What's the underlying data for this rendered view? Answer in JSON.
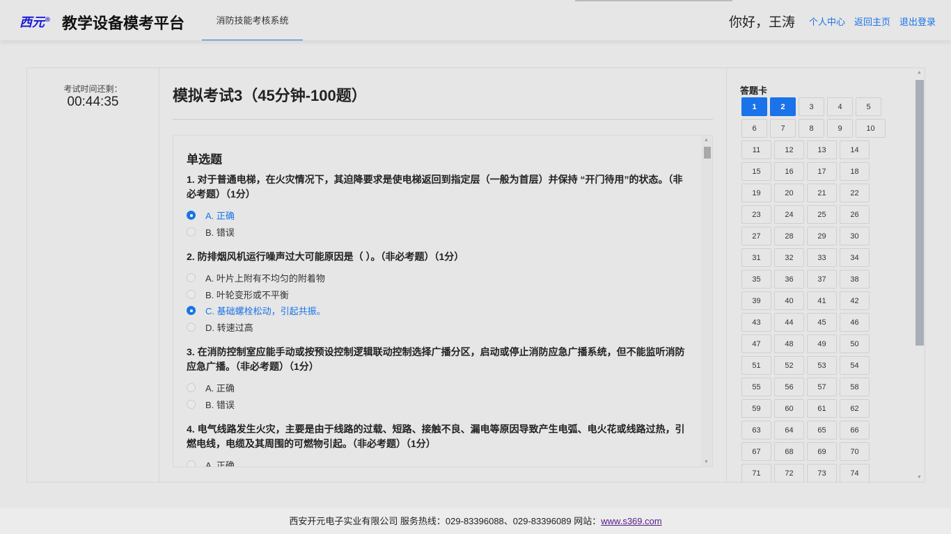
{
  "header": {
    "logo_text": "西元",
    "brand": "教学设备模考平台",
    "nav_tab": "消防技能考核系统",
    "greeting": "你好，王涛",
    "links": [
      "个人中心",
      "返回主页",
      "退出登录"
    ]
  },
  "timer": {
    "label": "考试时间还剩：",
    "value": "00:44:35"
  },
  "exam": {
    "title": "模拟考试3（45分钟-100题）",
    "section": "单选题",
    "questions": [
      {
        "text": "1. 对于普通电梯，在火灾情况下，其迫降要求是使电梯返回到指定层（一般为首层）并保持 “开门待用”的状态。（非必考题）（1分）",
        "options": [
          "A. 正确",
          "B. 错误"
        ],
        "selected": 0
      },
      {
        "text": "2. 防排烟风机运行噪声过大可能原因是（ ）。（非必考题）（1分）",
        "options": [
          "A. 叶片上附有不均匀的附着物",
          "B. 叶轮变形或不平衡",
          "C. 基础螺栓松动，引起共振。",
          "D. 转速过高"
        ],
        "selected": 2
      },
      {
        "text": "3. 在消防控制室应能手动或按预设控制逻辑联动控制选择广播分区，启动或停止消防应急广播系统，但不能监听消防应急广播。（非必考题）（1分）",
        "options": [
          "A. 正确",
          "B. 错误"
        ],
        "selected": -1
      },
      {
        "text": "4. 电气线路发生火灾，主要是由于线路的过载、短路、接触不良、漏电等原因导致产生电弧、电火花或线路过热，引燃电线，电缆及其周围的可燃物引起。（非必考题）（1分）",
        "options": [
          "A. 正确"
        ],
        "selected": -1
      }
    ]
  },
  "answer_card": {
    "title": "答题卡",
    "numbers": [
      "1",
      "2",
      "3",
      "4",
      "5",
      "6",
      "7",
      "8",
      "9",
      "10",
      "11",
      "12",
      "13",
      "14",
      "15",
      "16",
      "17",
      "18",
      "19",
      "20",
      "21",
      "22",
      "23",
      "24",
      "25",
      "26",
      "27",
      "28",
      "29",
      "30",
      "31",
      "32",
      "33",
      "34",
      "35",
      "36",
      "37",
      "38",
      "39",
      "40",
      "41",
      "42",
      "43",
      "44",
      "45",
      "46",
      "47",
      "48",
      "49",
      "50",
      "51",
      "52",
      "53",
      "54",
      "55",
      "56",
      "57",
      "58",
      "59",
      "60",
      "61",
      "62",
      "63",
      "64",
      "65",
      "66",
      "67",
      "68",
      "69",
      "70",
      "71",
      "72",
      "73",
      "74"
    ],
    "answered": [
      "1",
      "2"
    ],
    "colors": {
      "answered": "#1a73e8"
    }
  },
  "footer": {
    "text": "西安开元电子实业有限公司 服务热线：029-83396088、029-83396089 网站：",
    "link": "www.s369.com"
  }
}
